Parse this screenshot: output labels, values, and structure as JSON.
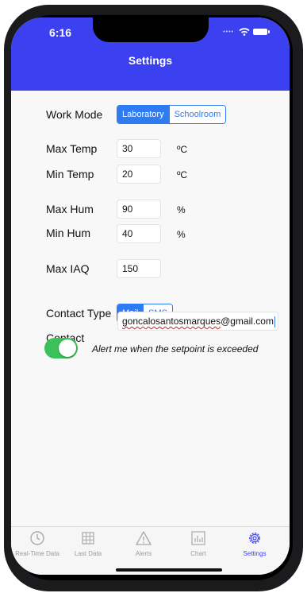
{
  "status": {
    "time": "6:16"
  },
  "header": {
    "title": "Settings"
  },
  "work_mode": {
    "label": "Work Mode",
    "options": [
      "Laboratory",
      "Schoolroom"
    ],
    "selected": "Laboratory"
  },
  "max_temp": {
    "label": "Max Temp",
    "value": "30",
    "unit": "ºC"
  },
  "min_temp": {
    "label": "Min Temp",
    "value": "20",
    "unit": "ºC"
  },
  "max_hum": {
    "label": "Max Hum",
    "value": "90",
    "unit": "%"
  },
  "min_hum": {
    "label": "Min Hum",
    "value": "40",
    "unit": "%"
  },
  "max_iaq": {
    "label": "Max IAQ",
    "value": "150"
  },
  "contact_type": {
    "label": "Contact Type",
    "options": [
      "Mail",
      "SMS"
    ],
    "selected": "Mail"
  },
  "contact": {
    "label": "Contact",
    "value_name": "goncalosantosmarques",
    "value_domain": "@gmail.com"
  },
  "alert": {
    "label": "Alert me when the setpoint is exceeded",
    "enabled": true
  },
  "tabs": [
    {
      "label": "Real-Time Data",
      "icon": "clock-icon"
    },
    {
      "label": "Last Data",
      "icon": "grid-icon"
    },
    {
      "label": "Alerts",
      "icon": "warning-icon"
    },
    {
      "label": "Chart",
      "icon": "chart-icon"
    },
    {
      "label": "Settings",
      "icon": "gear-icon",
      "active": true
    }
  ],
  "colors": {
    "header": "#3b40f0",
    "accent": "#2f7bf2",
    "toggle_on": "#3ac159"
  }
}
